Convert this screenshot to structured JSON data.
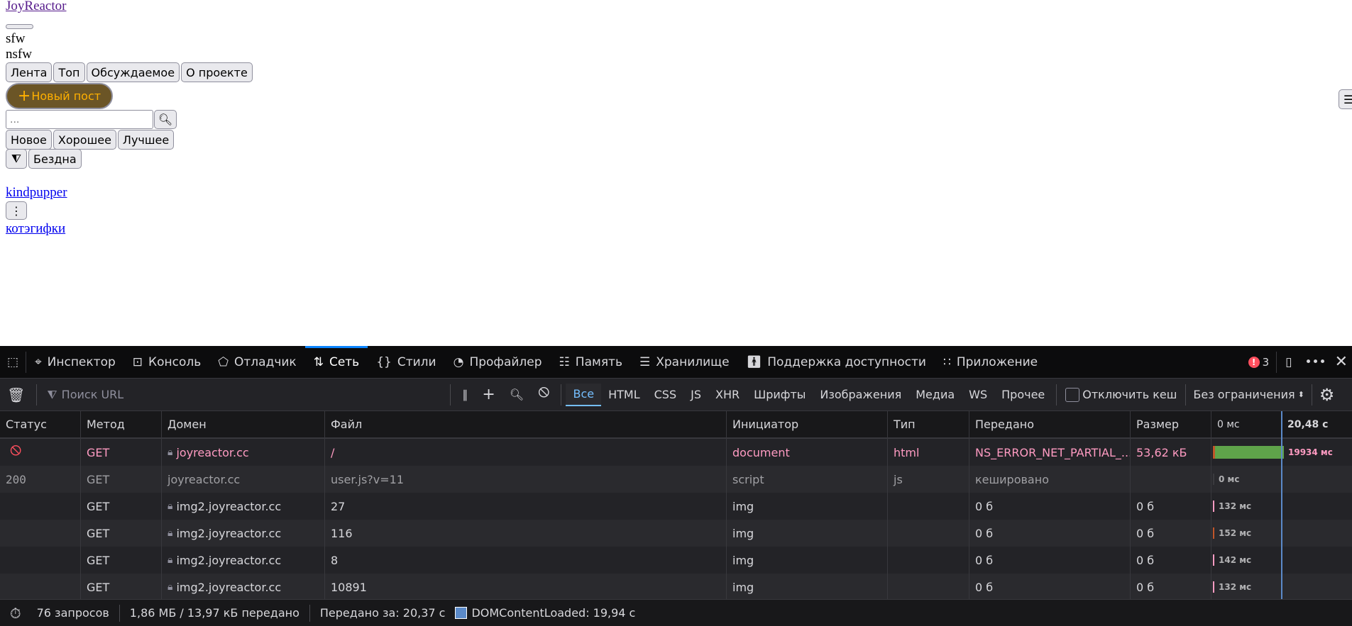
{
  "page": {
    "logo": "JoyReactor",
    "sfw": "sfw",
    "nsfw": "nsfw",
    "nav": [
      "Лента",
      "Топ",
      "Обсуждаемое",
      "О проекте"
    ],
    "new_post": "Новый пост",
    "search_placeholder": "...",
    "sort": [
      "Новое",
      "Хорошее",
      "Лучшее"
    ],
    "abyss": "Бездна",
    "user": "kindpupper",
    "tag": "котэгифки"
  },
  "devtools": {
    "tabs": [
      "Инспектор",
      "Консоль",
      "Отладчик",
      "Сеть",
      "Стили",
      "Профайлер",
      "Память",
      "Хранилище",
      "Поддержка доступности",
      "Приложение"
    ],
    "error_count": "3",
    "filter_placeholder": "Поиск URL",
    "type_filters": [
      "Все",
      "HTML",
      "CSS",
      "JS",
      "XHR",
      "Шрифты",
      "Изображения",
      "Медиа",
      "WS",
      "Прочее"
    ],
    "disable_cache": "Отключить кеш",
    "throttle": "Без ограничения",
    "columns": [
      "Статус",
      "Метод",
      "Домен",
      "Файл",
      "Инициатор",
      "Тип",
      "Передано",
      "Размер",
      "0 мс",
      "20,48 с"
    ],
    "rows": [
      {
        "status": "",
        "method": "GET",
        "domain": "joyreactor.cc",
        "file": "/",
        "initiator": "document",
        "type": "html",
        "transferred": "NS_ERROR_NET_PARTIAL_...",
        "size": "53,62 кБ",
        "time": "19934 мс",
        "state": "err"
      },
      {
        "status": "200",
        "method": "GET",
        "domain": "joyreactor.cc",
        "file": "user.js?v=11",
        "initiator": "script",
        "type": "js",
        "transferred": "кешировано",
        "size": "",
        "time": "0 мс",
        "state": "cached"
      },
      {
        "status": "",
        "method": "GET",
        "domain": "img2.joyreactor.cc",
        "file": "27",
        "initiator": "img",
        "type": "",
        "transferred": "0 б",
        "size": "0 б",
        "time": "132 мс",
        "state": ""
      },
      {
        "status": "",
        "method": "GET",
        "domain": "img2.joyreactor.cc",
        "file": "116",
        "initiator": "img",
        "type": "",
        "transferred": "0 б",
        "size": "0 б",
        "time": "152 мс",
        "state": ""
      },
      {
        "status": "",
        "method": "GET",
        "domain": "img2.joyreactor.cc",
        "file": "8",
        "initiator": "img",
        "type": "",
        "transferred": "0 б",
        "size": "0 б",
        "time": "142 мс",
        "state": ""
      },
      {
        "status": "",
        "method": "GET",
        "domain": "img2.joyreactor.cc",
        "file": "10891",
        "initiator": "img",
        "type": "",
        "transferred": "0 б",
        "size": "0 б",
        "time": "132 мс",
        "state": ""
      }
    ],
    "status": {
      "requests": "76 запросов",
      "transferred": "1,86 МБ / 13,97 кБ передано",
      "finish": "Передано за: 20,37 с",
      "dcl": "DOMContentLoaded: 19,94 с"
    }
  }
}
